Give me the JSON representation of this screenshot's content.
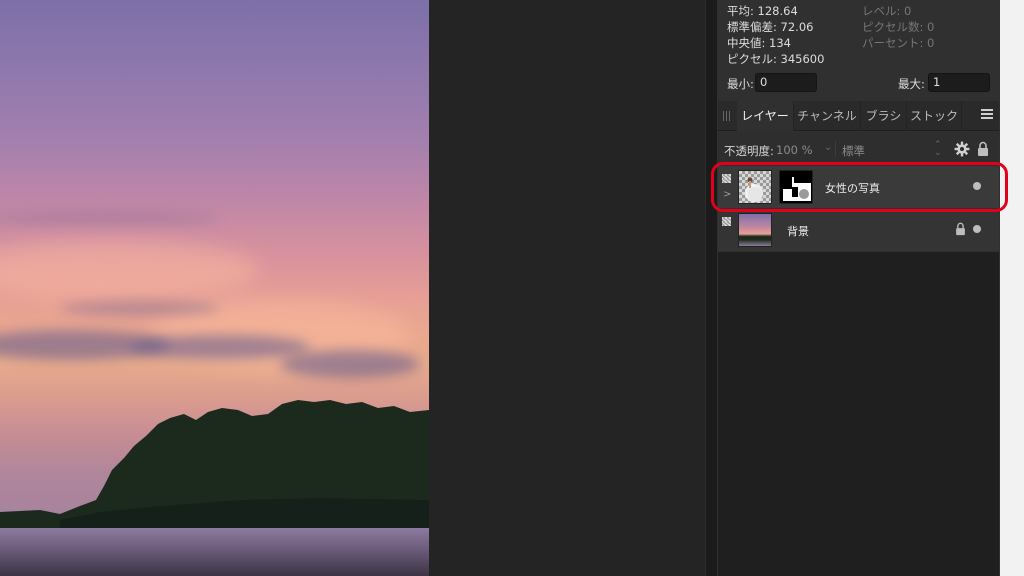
{
  "histogram": {
    "mean": "平均: 128.64",
    "std_dev": "標準偏差: 72.06",
    "median": "中央値: 134",
    "pixels": "ピクセル: 345600",
    "level": "レベル: 0",
    "pixel_count": "ピクセル数: 0",
    "percent": "パーセント: 0",
    "min_label": "最小:",
    "min_value": "0",
    "max_label": "最大:",
    "max_value": "1"
  },
  "tabs": [
    {
      "label": "レイヤー",
      "active": true
    },
    {
      "label": "チャンネル",
      "active": false
    },
    {
      "label": "ブラシ",
      "active": false
    },
    {
      "label": "ストック",
      "active": false
    }
  ],
  "layer_controls": {
    "opacity_label": "不透明度:",
    "opacity_value": "100 %",
    "blend_mode": "標準"
  },
  "layers": [
    {
      "name": "女性の写真",
      "visible": true,
      "locked": false
    },
    {
      "name": "背景",
      "visible": true,
      "locked": true
    }
  ],
  "colors": {
    "highlight": "#e3001b",
    "panel_bg": "#303030"
  },
  "icons": {
    "settings": "gear-icon",
    "lock": "lock-icon",
    "menu": "hamburger-menu-icon"
  }
}
